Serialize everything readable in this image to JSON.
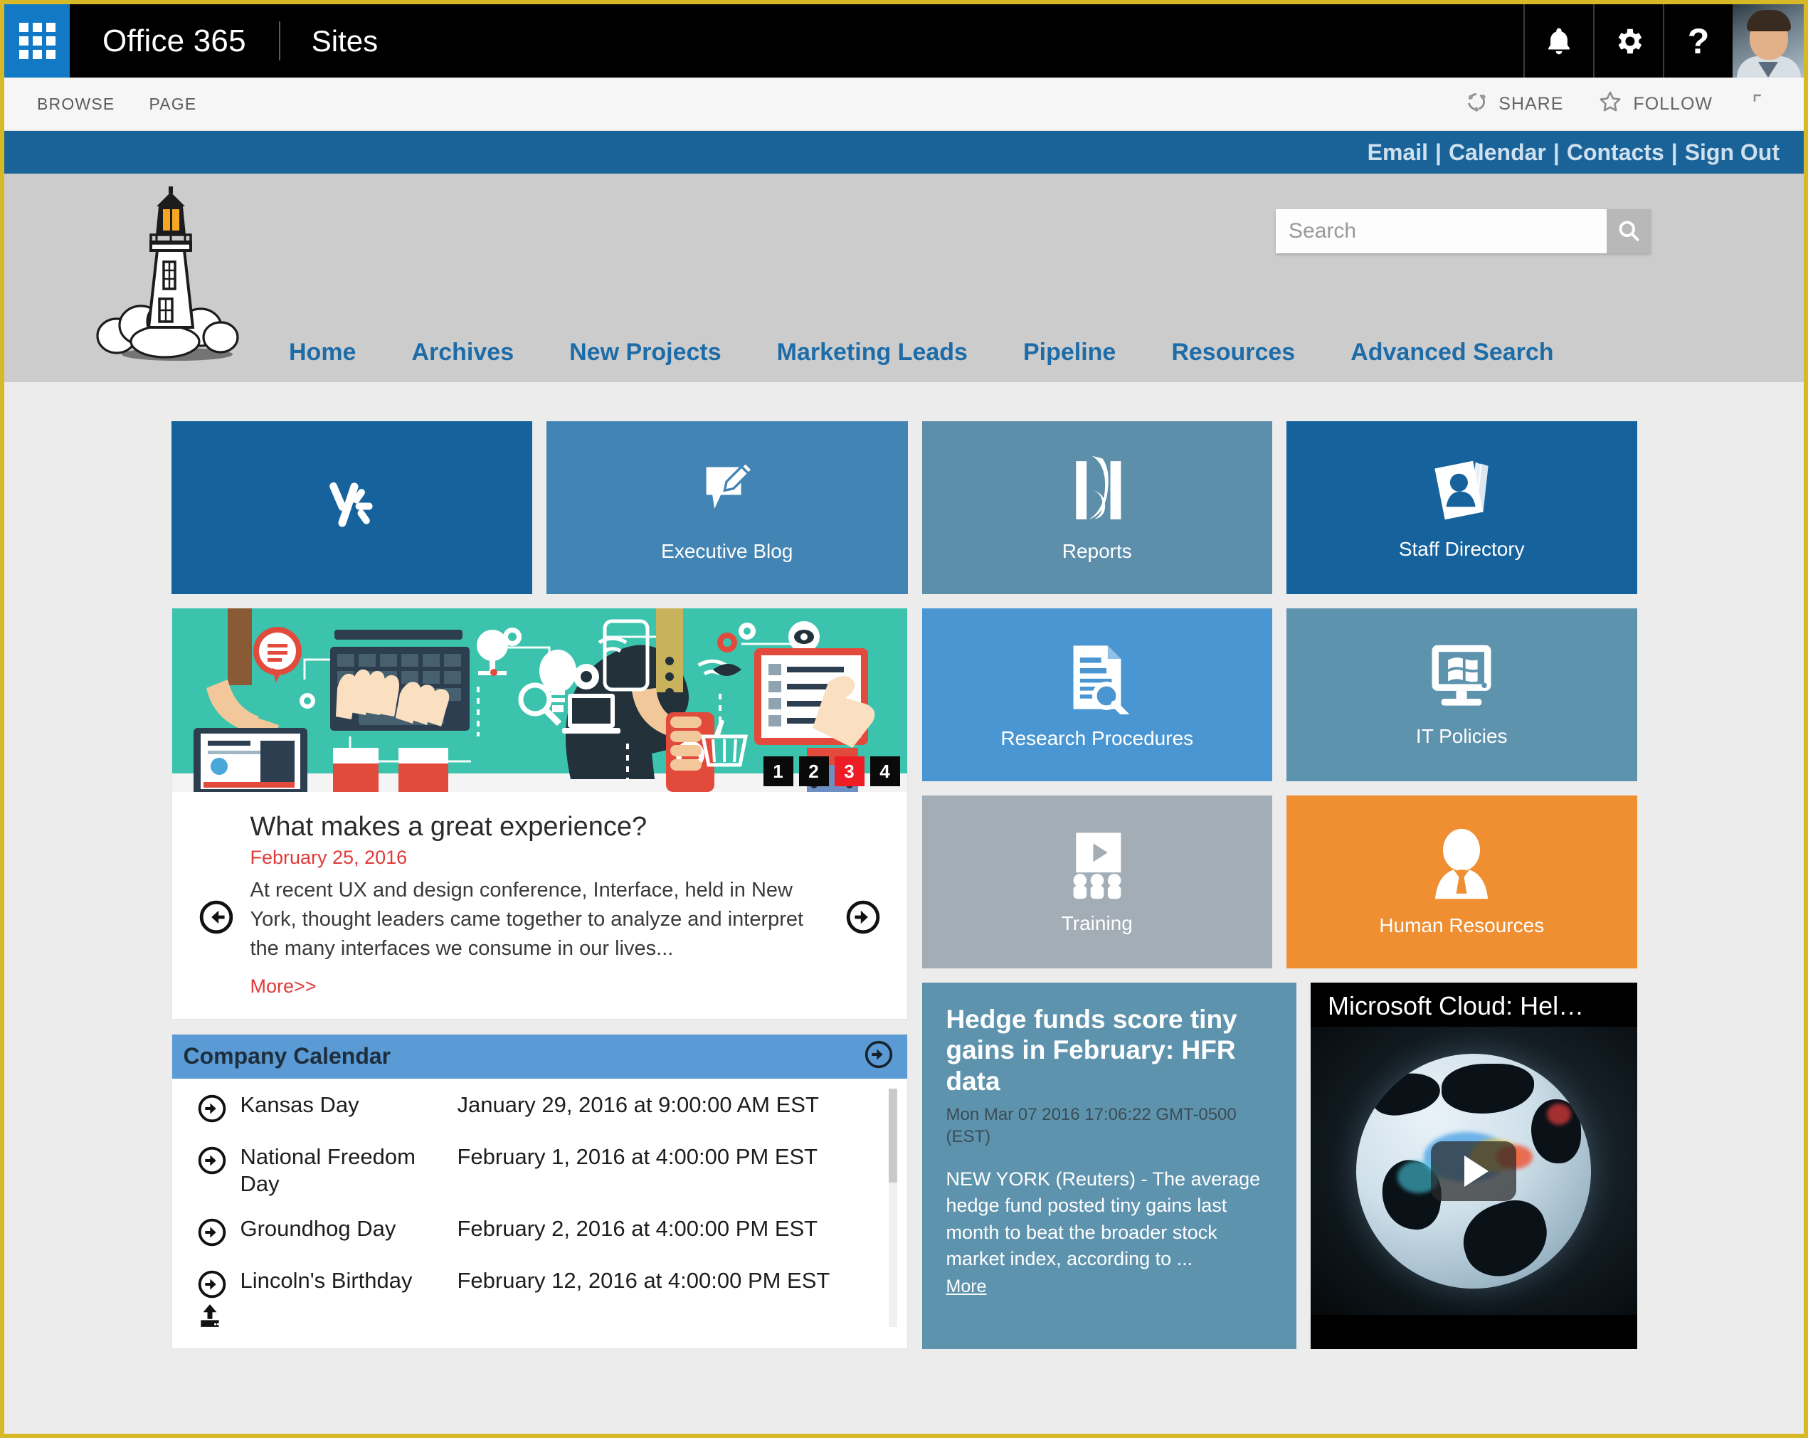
{
  "suite": {
    "waffle_label": "App launcher",
    "brand": "Office 365",
    "app": "Sites",
    "notifications_icon": "bell-icon",
    "settings_icon": "gear-icon",
    "help_icon": "help-icon",
    "avatar_label": "User photo"
  },
  "ribbon": {
    "tabs": [
      "BROWSE",
      "PAGE"
    ],
    "share_label": "SHARE",
    "follow_label": "FOLLOW",
    "focus_label": "Focus on Content"
  },
  "linkstrip": {
    "links": [
      "Email",
      "Calendar",
      "Contacts",
      "Sign Out"
    ],
    "separator": "|",
    "bg_color": "#1a6399"
  },
  "brand": {
    "logo_name": "lighthouse-logo"
  },
  "search": {
    "value": "",
    "placeholder": "Search",
    "button_icon": "search-icon"
  },
  "topnav": {
    "items": [
      "Home",
      "Archives",
      "New Projects",
      "Marketing Leads",
      "Pipeline",
      "Resources",
      "Advanced Search"
    ],
    "link_color": "#1d6ca8"
  },
  "tiles": [
    {
      "id": "yammer",
      "label": "",
      "icon": "yammer-icon",
      "color": "#16629c"
    },
    {
      "id": "blog",
      "label": "Executive Blog",
      "icon": "blog-pencil-icon",
      "color": "#4285b4"
    },
    {
      "id": "reports",
      "label": "Reports",
      "icon": "reports-book-icon",
      "color": "#5d8fab"
    },
    {
      "id": "staff",
      "label": "Staff Directory",
      "icon": "id-cards-icon",
      "color": "#16629c"
    },
    {
      "id": "research",
      "label": "Research Procedures",
      "icon": "document-search-icon",
      "color": "#4a96d2"
    },
    {
      "id": "itpolicy",
      "label": "IT Policies",
      "icon": "monitor-windows-icon",
      "color": "#5e93ae"
    },
    {
      "id": "training",
      "label": "Training",
      "icon": "presentation-video-icon",
      "color": "#a3adb5"
    },
    {
      "id": "hr",
      "label": "Human Resources",
      "icon": "person-tie-icon",
      "color": "#ef8f32"
    }
  ],
  "hero": {
    "image_name": "flat-design-technology-illustration",
    "title": "What makes a great experience?",
    "date": "February 25, 2016",
    "body": "At recent UX and design conference, Interface, held in New York, thought leaders came together to analyze and interpret the many interfaces we consume in our lives...",
    "more_label": "More>>",
    "prev_icon": "arrow-left-circle-icon",
    "next_icon": "arrow-right-circle-icon",
    "pager": [
      "1",
      "2",
      "3",
      "4"
    ],
    "active_page": "3",
    "active_color": "#ee1c25"
  },
  "calendar": {
    "title": "Company Calendar",
    "header_color": "#5b9bd5",
    "more_icon": "arrow-right-circle-icon",
    "upload_icon": "upload-icon",
    "events": [
      {
        "name": "Kansas Day",
        "when": "January 29, 2016 at 9:00:00 AM EST"
      },
      {
        "name": "National Freedom Day",
        "when": "February 1, 2016 at 4:00:00 PM EST"
      },
      {
        "name": "Groundhog Day",
        "when": "February 2, 2016 at 4:00:00 PM EST"
      },
      {
        "name": "Lincoln's Birthday",
        "when": "February 12, 2016 at 4:00:00 PM EST"
      }
    ]
  },
  "news": {
    "title": "Hedge funds score tiny gains in February: HFR data",
    "date": "Mon Mar 07 2016 17:06:22 GMT-0500 (EST)",
    "body": "NEW YORK (Reuters) - The average hedge fund posted tiny gains last month to beat the broader stock market index, according to ...",
    "more_label": "More",
    "bg_color": "#5e93ae"
  },
  "video": {
    "title": "Microsoft Cloud: Hel…",
    "play_icon": "play-button-icon",
    "thumbnail_name": "rotating-earth-globe-data-visualization"
  }
}
